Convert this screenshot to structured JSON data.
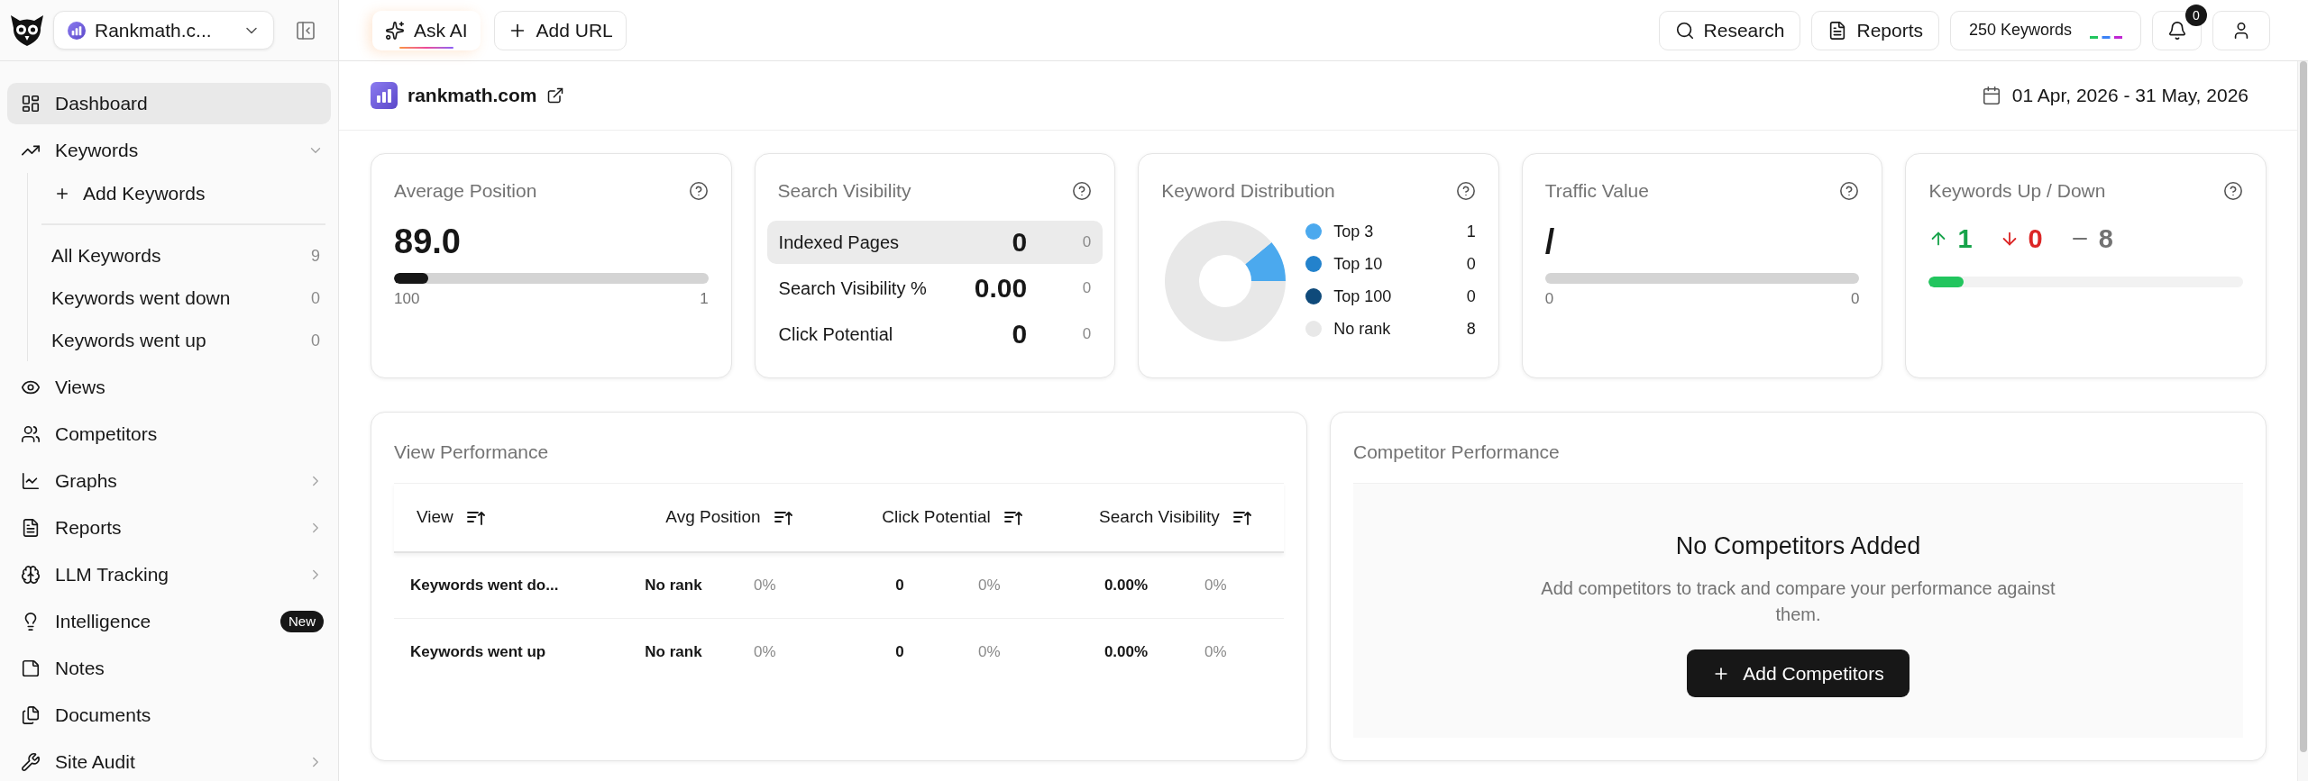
{
  "sidebar": {
    "workspace": "Rankmath.c...",
    "items": [
      {
        "label": "Dashboard",
        "selected": true
      },
      {
        "label": "Keywords",
        "selected": false,
        "expanded": true,
        "children": [
          {
            "kind": "action",
            "label": "Add Keywords"
          },
          {
            "kind": "view",
            "label": "All Keywords",
            "count": "9",
            "selected": false
          },
          {
            "kind": "view",
            "label": "Keywords went down",
            "count": "0",
            "selected": false
          },
          {
            "kind": "view",
            "label": "Keywords went up",
            "count": "0",
            "selected": false
          }
        ]
      },
      {
        "label": "Views",
        "selected": false
      },
      {
        "label": "Competitors",
        "selected": false
      },
      {
        "label": "Graphs",
        "selected": false,
        "expanded": false
      },
      {
        "label": "Reports",
        "selected": false,
        "expanded": false
      },
      {
        "label": "LLM Tracking",
        "selected": false,
        "expanded": false
      },
      {
        "label": "Intelligence",
        "selected": false,
        "badge": "New"
      },
      {
        "label": "Notes",
        "selected": false
      },
      {
        "label": "Documents",
        "selected": false
      },
      {
        "label": "Site Audit",
        "selected": false,
        "expanded": false
      }
    ]
  },
  "top_bar": {
    "actions": [
      {
        "kind": "ai",
        "label": "Ask AI"
      },
      {
        "kind": "add",
        "label": "Add URL"
      }
    ],
    "tools": [
      {
        "kind": "search",
        "label": "Research"
      },
      {
        "kind": "report",
        "label": "Reports"
      }
    ],
    "quota": "250 Keywords",
    "notification_count": "0"
  },
  "site": {
    "domain": "rankmath.com",
    "date_range": "01 Apr, 2026 - 31 May, 2026"
  },
  "average_position": {
    "title": "Average Position",
    "value": "89.0",
    "level": 0.11,
    "min_label": "100",
    "max_label": "1"
  },
  "search_visibility": {
    "title": "Search Visibility",
    "rows": [
      {
        "label": "Indexed Pages",
        "value": "0",
        "change": "0",
        "selected": true
      },
      {
        "label": "Search Visibility %",
        "value": "0.00",
        "change": "0",
        "selected": false
      },
      {
        "label": "Click Potential",
        "value": "0",
        "change": "0",
        "selected": false
      }
    ]
  },
  "keyword_distribution": {
    "title": "Keyword Distribution",
    "chart_data": {
      "type": "donut",
      "categories": [
        "Top 3",
        "Top 10",
        "Top 100",
        "No rank"
      ],
      "values": [
        11.1,
        0,
        0,
        88.9
      ]
    },
    "legend": [
      {
        "count": "1",
        "color": "#4ba9ee"
      },
      {
        "count": "0",
        "color": "#2382cc"
      },
      {
        "count": "0",
        "color": "#0f4a7a"
      },
      {
        "count": "8",
        "color": "#e8e8e8"
      }
    ]
  },
  "traffic_value": {
    "title": "Traffic Value",
    "value": "/",
    "min_label": "0",
    "max_label": "0"
  },
  "keywords_up_down": {
    "title": "Keywords Up / Down",
    "changes": [
      {
        "kind": "up",
        "value": "1"
      },
      {
        "kind": "down",
        "value": "0"
      },
      {
        "kind": "same",
        "value": "8"
      }
    ],
    "level": 0.11
  },
  "view_performance": {
    "title": "View Performance",
    "columns": [
      "View",
      "Avg Position",
      "Click Potential",
      "Search Visibility"
    ],
    "rows": [
      {
        "view": "Keywords went do...",
        "avg_position": "No rank",
        "avg_position_change": "0%",
        "click_potential": "0",
        "click_potential_change": "0%",
        "search_visibility": "0.00%",
        "search_visibility_change": "0%"
      },
      {
        "view": "Keywords went up",
        "avg_position": "No rank",
        "avg_position_change": "0%",
        "click_potential": "0",
        "click_potential_change": "0%",
        "search_visibility": "0.00%",
        "search_visibility_change": "0%"
      }
    ]
  },
  "competitor_performance": {
    "title": "Competitor Performance",
    "empty_title": "No Competitors Added",
    "empty_text": "Add competitors to track and compare your performance against them.",
    "button": "Add Competitors"
  }
}
